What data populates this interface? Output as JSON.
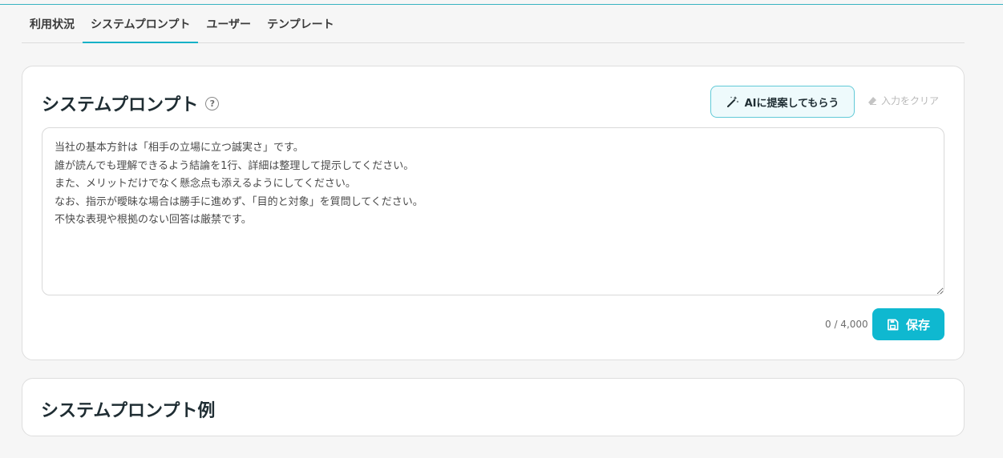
{
  "tabs": [
    {
      "label": "利用状況",
      "active": false
    },
    {
      "label": "システムプロンプト",
      "active": true
    },
    {
      "label": "ユーザー",
      "active": false
    },
    {
      "label": "テンプレート",
      "active": false
    }
  ],
  "main": {
    "title": "システムプロンプト",
    "help_glyph": "?",
    "ai_button_label": "AIに提案してもらう",
    "ai_button_icon": "magic-wand-icon",
    "clear_label": "入力をクリア",
    "clear_icon": "eraser-icon",
    "prompt_text": "当社の基本方針は「相手の立場に立つ誠実さ」です。\n誰が読んでも理解できるよう結論を1行、詳細は整理して提示してください。\nまた、メリットだけでなく懸念点も添えるようにしてください。\nなお、指示が曖昧な場合は勝手に進めず、「目的と対象」を質問してください。\n不快な表現や根拠のない回答は厳禁です。",
    "char_count": "0 / 4,000",
    "save_label": "保存",
    "save_icon": "floppy-disk-icon"
  },
  "examples": {
    "title": "システムプロンプト例"
  },
  "colors": {
    "accent": "#0fb8d0",
    "accent_light": "#eefafc",
    "background": "#f6f6f6"
  }
}
